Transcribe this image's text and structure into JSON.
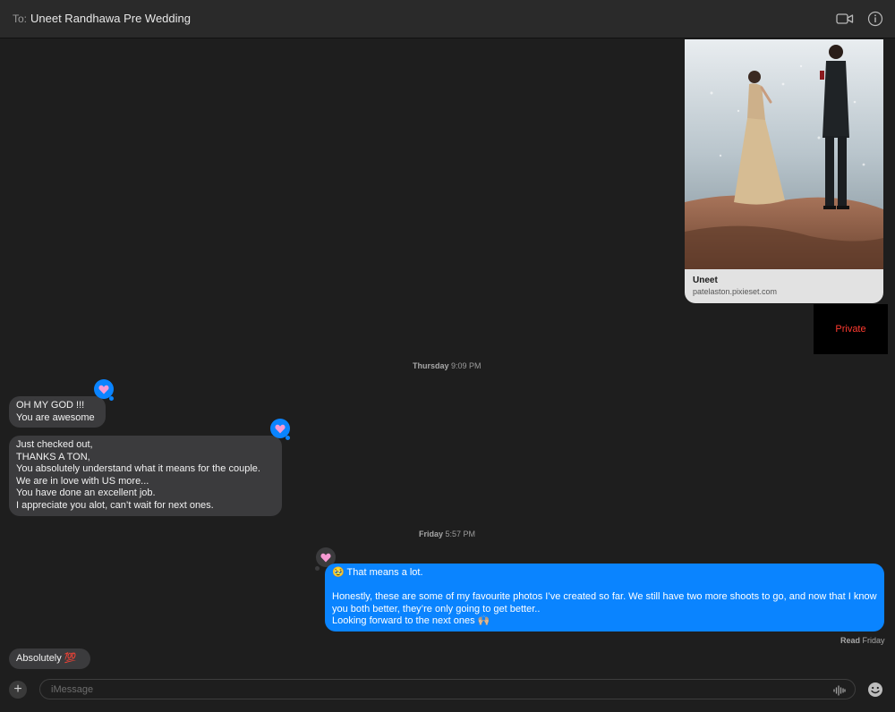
{
  "header": {
    "to_label": "To:",
    "recipient": "Uneet Randhawa Pre Wedding",
    "icons": [
      "video-camera-icon",
      "info-icon"
    ]
  },
  "link_preview": {
    "title": "Uneet",
    "url": "patelaston.pixieset.com"
  },
  "private_label": "Private",
  "timestamps": [
    {
      "day": "Thursday",
      "time": "9:09 PM"
    },
    {
      "day": "Friday",
      "time": "5:57 PM"
    }
  ],
  "messages": [
    {
      "direction": "incoming",
      "text": "OH MY GOD !!!\nYou are awesome",
      "reaction": "heart"
    },
    {
      "direction": "incoming",
      "text": "Just checked out,\nTHANKS A TON,\nYou absolutely understand what it means for the couple.\nWe are in love with US more...\nYou have done an excellent job.\nI appreciate you alot, can’t wait for next ones.",
      "reaction": "heart"
    },
    {
      "direction": "outgoing",
      "text": "🥹 That means a lot.\n\nHonestly, these are some of my favourite photos I’ve created so far. We still have two more shoots to go, and now that I know you both better, they’re only going to get better..\nLooking forward to the next ones 🙌🏼",
      "reaction": "heart"
    },
    {
      "direction": "incoming",
      "text": "Absolutely 💯",
      "reaction": ""
    }
  ],
  "read_receipt": {
    "label": "Read",
    "day": "Friday"
  },
  "composer": {
    "placeholder": "iMessage"
  },
  "colors": {
    "outgoing": "#0a84ff",
    "incoming": "#3b3b3d",
    "background": "#1e1e1e",
    "private": "#ff3b30"
  }
}
